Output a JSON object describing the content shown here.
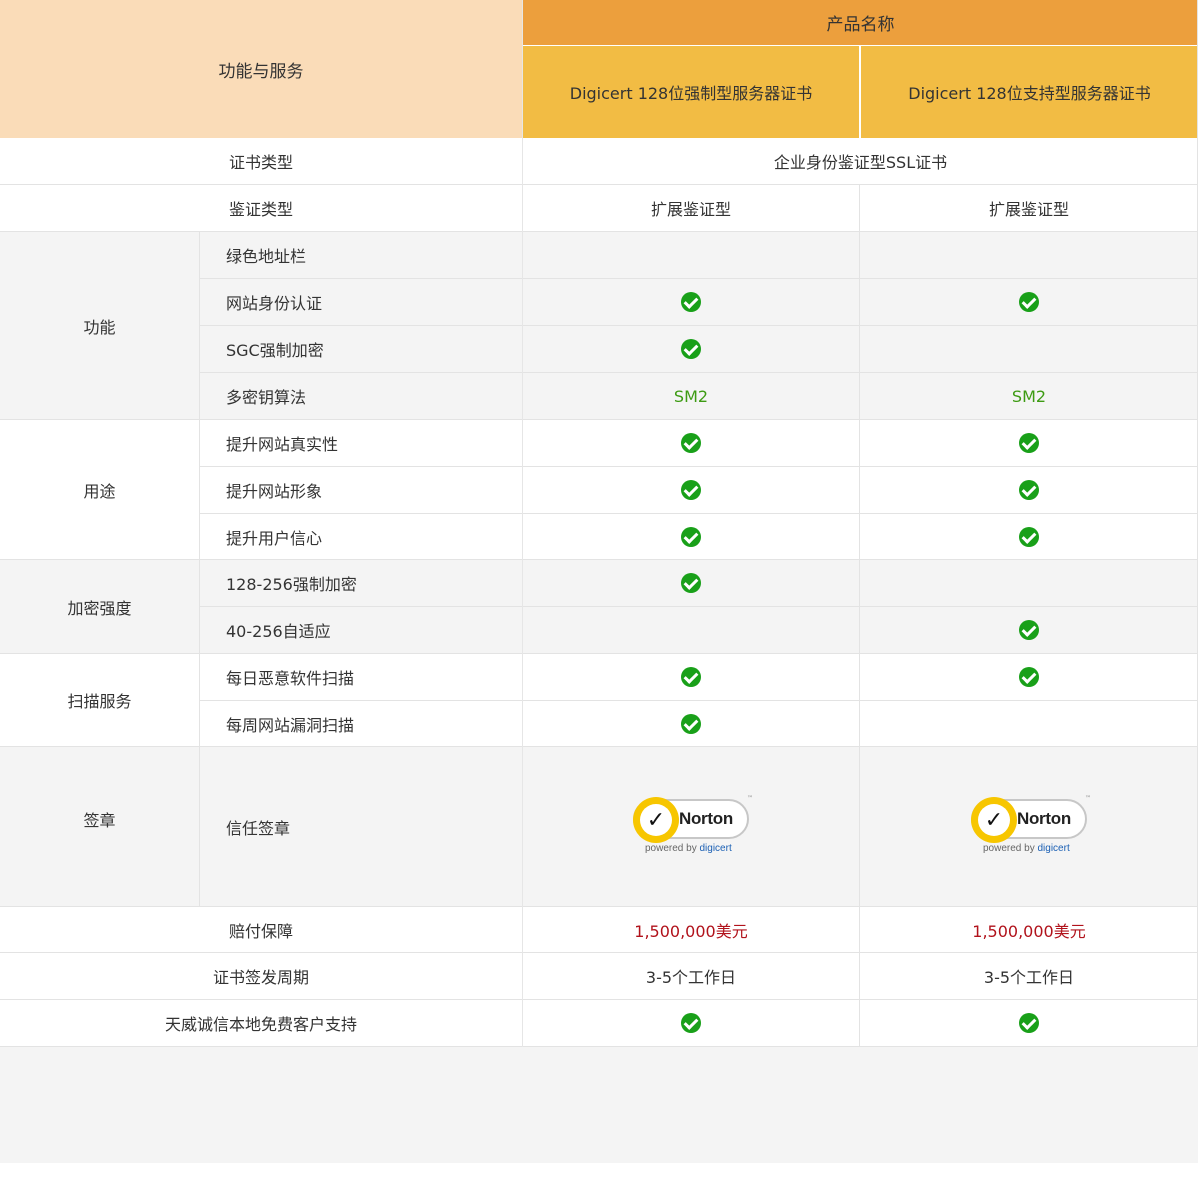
{
  "header": {
    "feature_label": "功能与服务",
    "product_group": "产品名称",
    "products": [
      "Digicert 128位强制型服务器证书",
      "Digicert 128位支持型服务器证书"
    ]
  },
  "rows": {
    "cert_type": {
      "label": "证书类型",
      "value": "企业身份鉴证型SSL证书"
    },
    "verify_type": {
      "label": "鉴证类型",
      "values": [
        "扩展鉴证型",
        "扩展鉴证型"
      ]
    },
    "features": {
      "group": "功能",
      "items": [
        "绿色地址栏",
        "网站身份认证",
        "SGC强制加密",
        "多密钥算法"
      ],
      "multi_key_values": [
        "SM2",
        "SM2"
      ]
    },
    "usage": {
      "group": "用途",
      "items": [
        "提升网站真实性",
        "提升网站形象",
        "提升用户信心"
      ]
    },
    "encryption": {
      "group": "加密强度",
      "items": [
        "128-256强制加密",
        "40-256自适应"
      ]
    },
    "scan": {
      "group": "扫描服务",
      "items": [
        "每日恶意软件扫描",
        "每周网站漏洞扫描"
      ]
    },
    "seal": {
      "group": "签章",
      "item": "信任签章",
      "logo_word": "Norton",
      "powered_by": "powered by",
      "powered_brand": "digicert"
    },
    "warranty": {
      "label": "赔付保障",
      "values": [
        "1,500,000美元",
        "1,500,000美元"
      ]
    },
    "issue_period": {
      "label": "证书签发周期",
      "values": [
        "3-5个工作日",
        "3-5个工作日"
      ]
    },
    "support": {
      "label": "天威诚信本地免费客户支持"
    }
  },
  "icons": {
    "check": "check-circle-icon"
  },
  "colors": {
    "header_left": "#fadcb8",
    "header_top": "#ec9f3d",
    "header_products": "#f2bc44",
    "check_green": "#19a019",
    "sm2_green": "#3d9b13",
    "warranty_red": "#b1121b"
  }
}
